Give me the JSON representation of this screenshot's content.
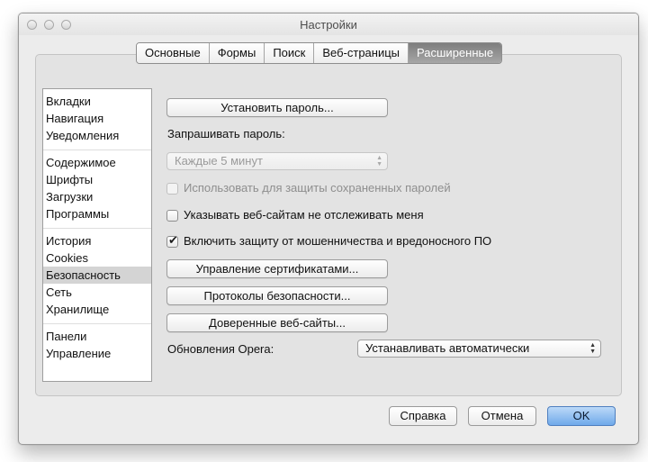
{
  "window": {
    "title": "Настройки"
  },
  "tabs": [
    "Основные",
    "Формы",
    "Поиск",
    "Веб-страницы",
    "Расширенные"
  ],
  "active_tab": "Расширенные",
  "sidebar": {
    "groups": [
      [
        "Вкладки",
        "Навигация",
        "Уведомления"
      ],
      [
        "Содержимое",
        "Шрифты",
        "Загрузки",
        "Программы"
      ],
      [
        "История",
        "Cookies",
        "Безопасность",
        "Сеть",
        "Хранилище"
      ],
      [
        "Панели",
        "Управление"
      ]
    ],
    "selected": "Безопасность"
  },
  "security": {
    "set_password_button": "Установить пароль...",
    "ask_password_label": "Запрашивать пароль:",
    "ask_password_value": "Каждые 5 минут",
    "use_for_saved_passwords": {
      "label": "Использовать для защиты сохраненных паролей",
      "checked": false,
      "enabled": false
    },
    "do_not_track": {
      "label": "Указывать веб-сайтам не отслеживать меня",
      "checked": false,
      "enabled": true
    },
    "fraud_protection": {
      "label": "Включить защиту от мошенничества и вредоносного ПО",
      "checked": true,
      "enabled": true
    },
    "manage_certificates_button": "Управление сертификатами...",
    "security_protocols_button": "Протоколы безопасности...",
    "trusted_sites_button": "Доверенные веб-сайты...",
    "updates_label": "Обновления Opera:",
    "updates_value": "Устанавливать автоматически"
  },
  "dialog_buttons": {
    "help": "Справка",
    "cancel": "Отмена",
    "ok": "OK"
  },
  "check_glyph": "✔",
  "colors": {
    "primary_button": "#6fa9ea",
    "active_tab": "#8e8e8e",
    "selected_sidebar": "#d4d4d4"
  }
}
